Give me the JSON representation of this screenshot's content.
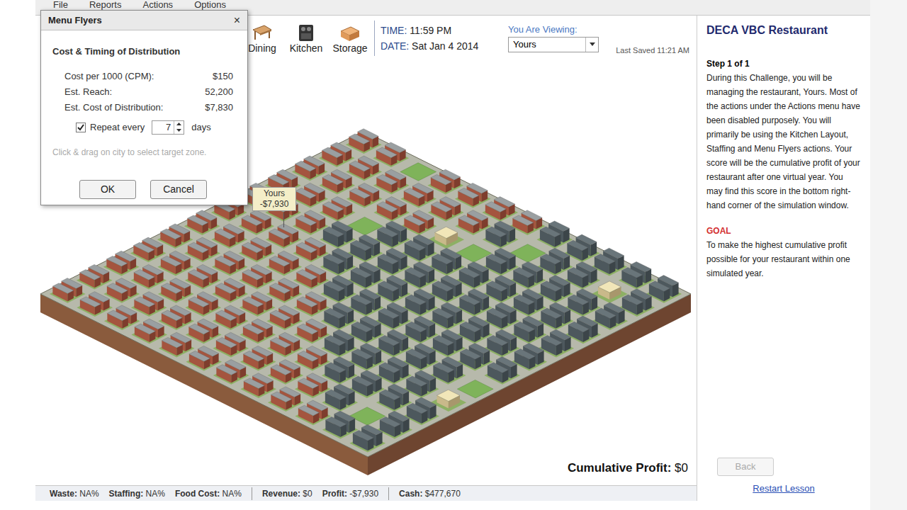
{
  "menu_bar": [
    "File",
    "Reports",
    "Actions",
    "Options"
  ],
  "toolbar": {
    "buttons": [
      {
        "label": "Dining"
      },
      {
        "label": "Kitchen"
      },
      {
        "label": "Storage"
      }
    ],
    "time_label": "TIME:",
    "time": "11:59 PM",
    "date_label": "DATE:",
    "date": "Sat Jan 4 2014",
    "viewing_label": "You Are Viewing:",
    "viewing": "Yours",
    "last_saved": "Last Saved 11:21 AM"
  },
  "dialog": {
    "title": "Menu Flyers",
    "close": "×",
    "section": "Cost & Timing of Distribution",
    "rows": [
      {
        "label": "Cost per 1000 (CPM):",
        "value": "$150"
      },
      {
        "label": "Est. Reach:",
        "value": "52,200"
      },
      {
        "label": "Est. Cost of Distribution:",
        "value": "$7,830"
      }
    ],
    "repeat": {
      "checked": true,
      "label": "Repeat every",
      "value": "7",
      "unit": "days"
    },
    "hint": "Click & drag on city to select target zone.",
    "buttons": [
      "OK",
      "Cancel"
    ]
  },
  "map": {
    "tooltip": {
      "name": "Yours",
      "value": "-$7,930"
    },
    "cumulative_profit_label": "Cumulative Profit:",
    "cumulative_profit": "$0"
  },
  "status_bar": [
    {
      "label": "Waste:",
      "value": "NA%"
    },
    {
      "label": "Staffing:",
      "value": "NA%"
    },
    {
      "label": "Food Cost:",
      "value": "NA%"
    },
    {
      "label": "Revenue:",
      "value": "$0"
    },
    {
      "label": "Profit:",
      "value": "-$7,930"
    },
    {
      "label": "Cash:",
      "value": "$477,670"
    }
  ],
  "panel": {
    "title": "DECA VBC Restaurant",
    "step": "Step 1 of 1",
    "body": "During this Challenge, you will be managing the restaurant, Yours. Most of the actions under the Actions menu have been disabled purposely. You will primarily be using the Kitchen Layout, Staffing and Menu Flyers actions. Your score will be the cumulative profit of your restaurant after one virtual year. You may find this score in the bottom right-hand corner of the simulation window.",
    "goal_label": "GOAL",
    "goal": "To make the highest cumulative profit possible for your restaurant within one simulated year.",
    "back": {
      "label": "Back",
      "disabled": true
    },
    "restart": "Restart Lesson"
  }
}
